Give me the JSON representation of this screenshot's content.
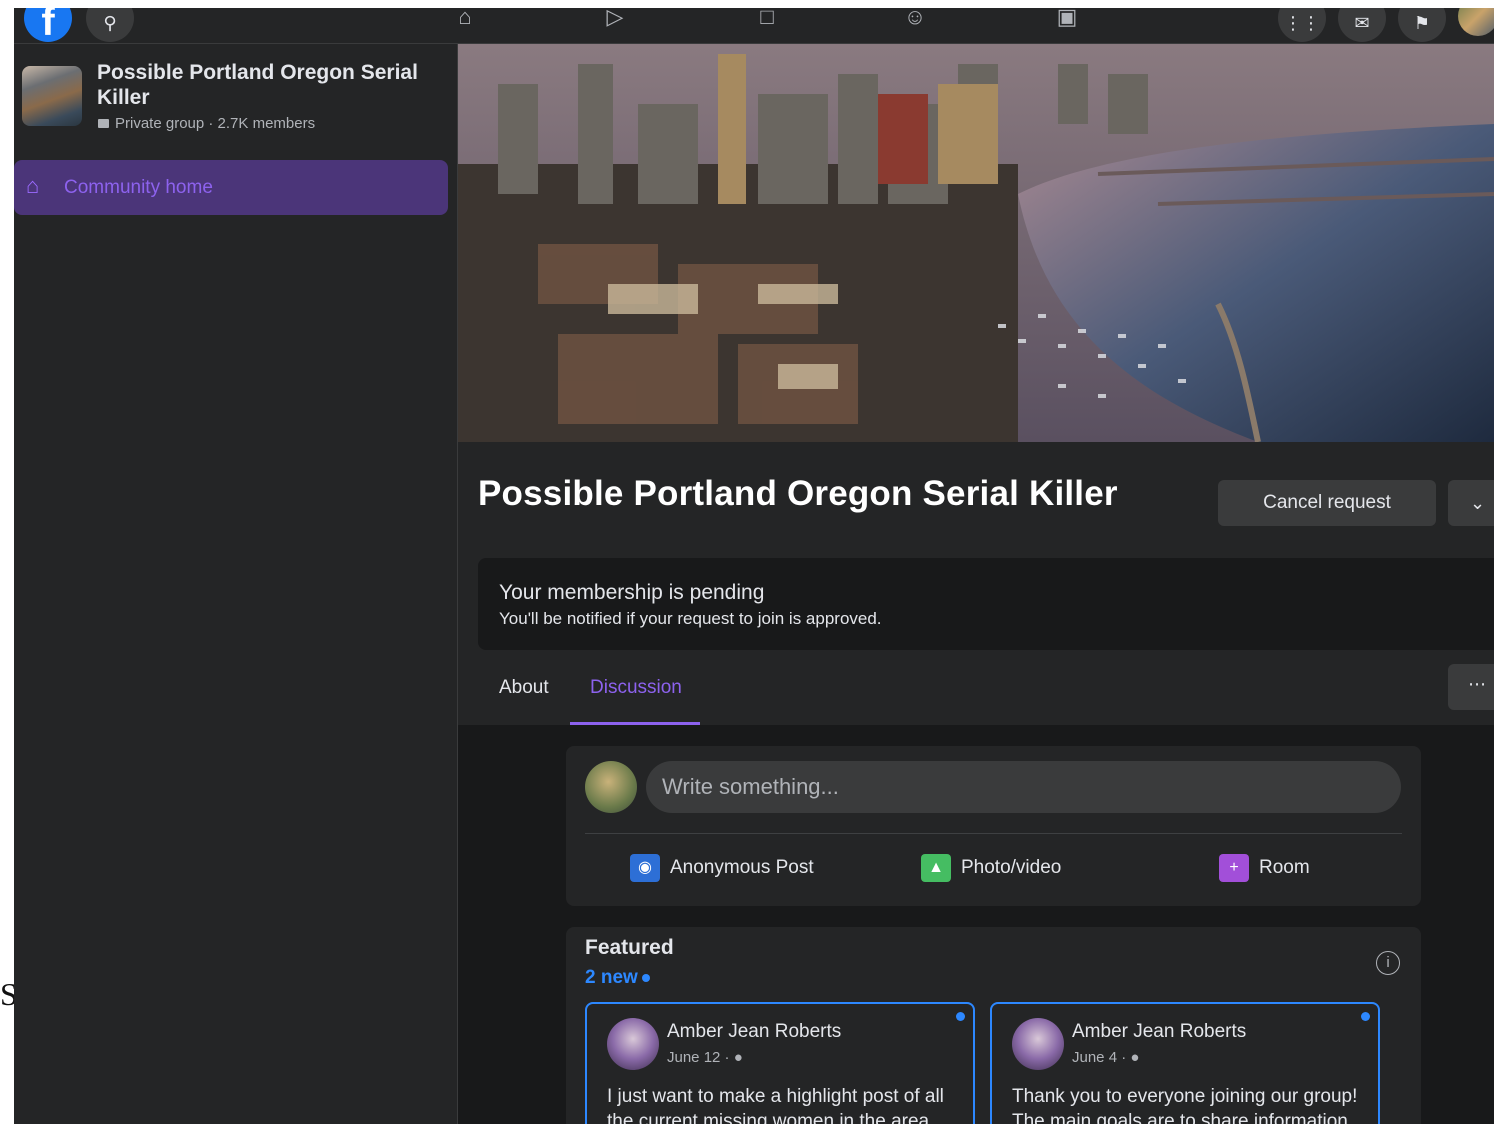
{
  "stray": "S",
  "nav": {
    "logo": "f",
    "search_icon": "search-icon",
    "icons": [
      "home-icon",
      "watch-icon",
      "marketplace-icon",
      "groups-icon",
      "gaming-icon",
      "menu-grid-icon",
      "messenger-icon",
      "notifications-icon"
    ]
  },
  "sidebar": {
    "group_name": "Possible Portland Oregon Serial Killer",
    "group_meta": "Private group · 2.7K members",
    "items": [
      {
        "label": "Community home",
        "icon": "home-icon"
      }
    ]
  },
  "group": {
    "title": "Possible Portland Oregon Serial Killer",
    "cancel_label": "Cancel request",
    "pending_title": "Your membership is pending",
    "pending_sub": "You'll be notified if your request to join is approved.",
    "tabs": [
      {
        "label": "About"
      },
      {
        "label": "Discussion",
        "active": true
      }
    ]
  },
  "composer": {
    "placeholder": "Write something...",
    "actions": [
      {
        "label": "Anonymous Post",
        "icon": "anonymous-icon"
      },
      {
        "label": "Photo/video",
        "icon": "photo-icon"
      },
      {
        "label": "Room",
        "icon": "room-video-icon"
      }
    ]
  },
  "featured": {
    "title": "Featured",
    "new_count": "2 new",
    "posts": [
      {
        "author": "Amber Jean Roberts",
        "date": "June 12 · ",
        "text": "I just want to make a highlight post of all the current missing women in the area."
      },
      {
        "author": "Amber Jean Roberts",
        "date": "June 4 · ",
        "text": "Thank you to everyone joining our group! The main goals are to share information"
      }
    ]
  },
  "colors": {
    "accent": "#8d62ee",
    "link_blue": "#2d88ff",
    "background": "#18191a",
    "surface": "#242526"
  }
}
